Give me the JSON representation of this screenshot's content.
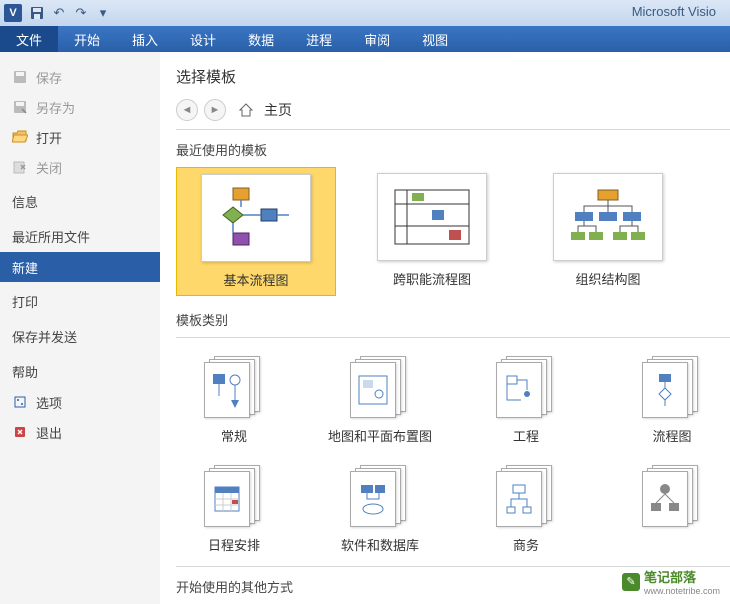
{
  "appTitle": "Microsoft Visio",
  "ribbonTabs": [
    "文件",
    "开始",
    "插入",
    "设计",
    "数据",
    "进程",
    "审阅",
    "视图"
  ],
  "sidebar": {
    "items": [
      {
        "label": "保存",
        "icon": "save",
        "disabled": true
      },
      {
        "label": "另存为",
        "icon": "saveas",
        "disabled": true
      },
      {
        "label": "打开",
        "icon": "open",
        "disabled": false
      },
      {
        "label": "关闭",
        "icon": "close",
        "disabled": true
      }
    ],
    "info": "信息",
    "recent": "最近所用文件",
    "new": "新建",
    "print": "打印",
    "send": "保存并发送",
    "help": "帮助",
    "options": "选项",
    "exit": "退出"
  },
  "content": {
    "title": "选择模板",
    "home": "主页",
    "recentTitle": "最近使用的模板",
    "recentTemplates": [
      "基本流程图",
      "跨职能流程图",
      "组织结构图"
    ],
    "categoryTitle": "模板类别",
    "categories1": [
      "常规",
      "地图和平面布置图",
      "工程",
      "流程图"
    ],
    "categories2": [
      "日程安排",
      "软件和数据库",
      "商务"
    ],
    "otherTitle": "开始使用的其他方式"
  },
  "watermark": {
    "text": "笔记部落",
    "url": "www.notetribe.com"
  }
}
